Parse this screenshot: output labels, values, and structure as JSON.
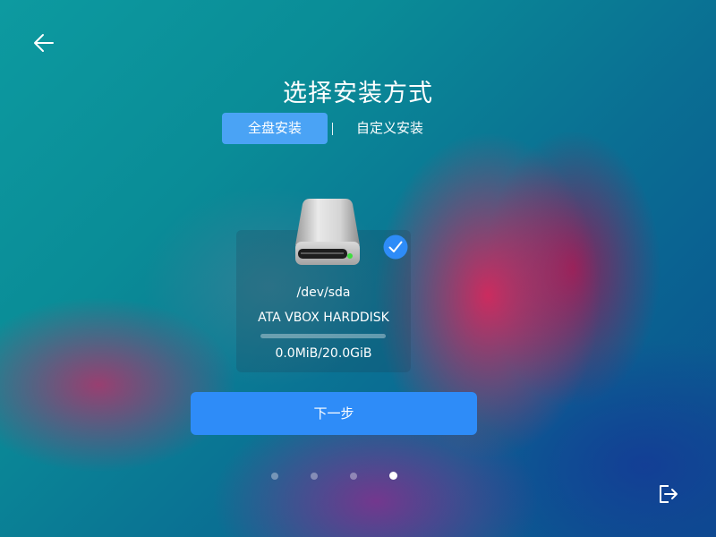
{
  "page": {
    "title": "选择安装方式"
  },
  "tabs": [
    {
      "label": "全盘安装",
      "active": true
    },
    {
      "label": "自定义安装",
      "active": false
    }
  ],
  "disk": {
    "path": "/dev/sda",
    "model": "ATA VBOX HARDDISK",
    "size_text": "0.0MiB/20.0GiB",
    "usage_fraction": 0,
    "selected": true,
    "icon": "hard-disk-icon"
  },
  "next_button": {
    "label": "下一步"
  },
  "pagination": {
    "total": 4,
    "current": 4
  },
  "icons": {
    "back": "back-arrow-icon",
    "check": "check-icon",
    "exit": "exit-icon"
  },
  "colors": {
    "accent": "#2e8cf8",
    "tab_active": "#4aa3f5",
    "check": "#2e8cf8"
  }
}
